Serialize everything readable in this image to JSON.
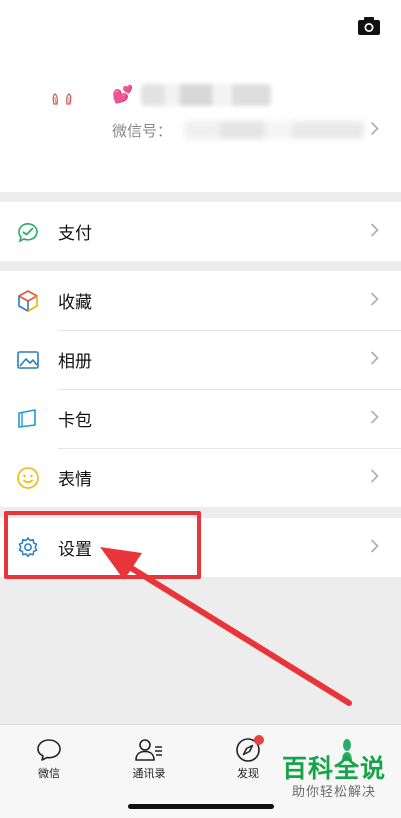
{
  "profile": {
    "decoration": "💕",
    "wechat_id_label": "微信号：",
    "avatar_icon": "bunny-ears-icon",
    "camera_icon": "camera-icon"
  },
  "menu": {
    "pay": {
      "label": "支付",
      "icon": "wechat-pay-icon",
      "color": "#2aae67"
    },
    "favorites": {
      "label": "收藏",
      "icon": "cube-icon"
    },
    "album": {
      "label": "相册",
      "icon": "photo-icon",
      "color": "#2c7fc2"
    },
    "cards": {
      "label": "卡包",
      "icon": "card-icon",
      "color": "#1f9bd6"
    },
    "stickers": {
      "label": "表情",
      "icon": "smiley-icon",
      "color": "#f5b800"
    },
    "settings": {
      "label": "设置",
      "icon": "gear-icon",
      "color": "#2c7fc2"
    }
  },
  "annotation": {
    "color": "#e8353a"
  },
  "tabbar": {
    "chats": "微信",
    "contacts": "通讯录",
    "discover": "发现"
  },
  "watermark": {
    "title": "百科全说",
    "subtitle": "助你轻松解决",
    "color": "#16a34a"
  }
}
